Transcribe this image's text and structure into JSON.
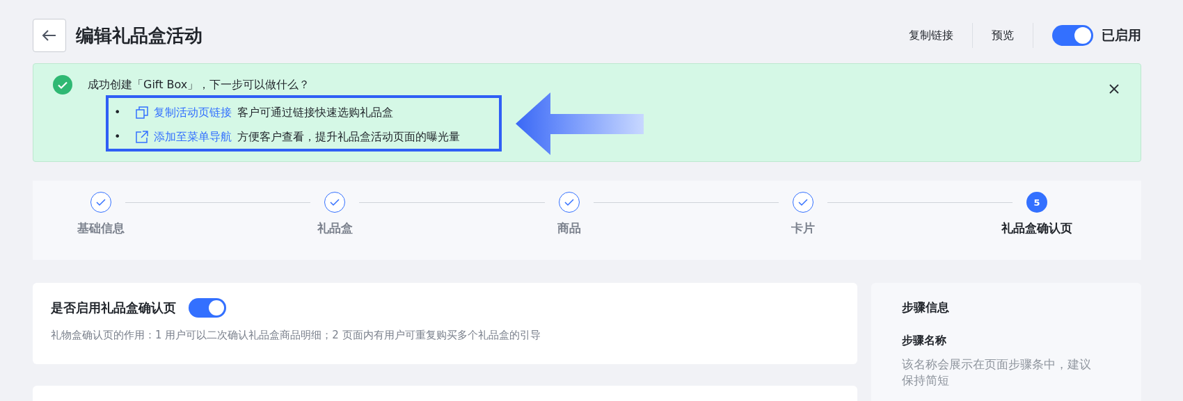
{
  "header": {
    "title": "编辑礼品盒活动",
    "actions": [
      "复制链接",
      "预览"
    ],
    "status": {
      "on": true,
      "label": "已启用"
    }
  },
  "alert": {
    "message": "成功创建「Gift Box」，下一步可以做什么？",
    "items": [
      {
        "kind": "copy",
        "bullet": "•",
        "link": "复制活动页链接",
        "text": "客户可通过链接快速选购礼品盒"
      },
      {
        "kind": "external",
        "bullet": "•",
        "link": "添加至菜单导航",
        "text": "方便客户查看，提升礼品盒活动页面的曝光量"
      }
    ]
  },
  "steps": [
    {
      "label": "基础信息",
      "done": true,
      "selected": false
    },
    {
      "label": "礼品盒",
      "done": true,
      "selected": false
    },
    {
      "label": "商品",
      "done": true,
      "selected": false
    },
    {
      "label": "卡片",
      "done": true,
      "selected": false
    },
    {
      "label": "礼品盒确认页",
      "done": false,
      "selected": true,
      "number": "5"
    }
  ],
  "confirm": {
    "label": "是否启用礼品盒确认页",
    "on": true,
    "description": "礼物盒确认页的作用：1 用户可以二次确认礼品盒商品明细；2 页面内有用户可重复购买多个礼品盒的引导"
  },
  "step_info": {
    "title": "步骤信息",
    "field_label": "步骤名称",
    "hint": "该名称会展示在页面步骤条中，建议保持简短"
  }
}
